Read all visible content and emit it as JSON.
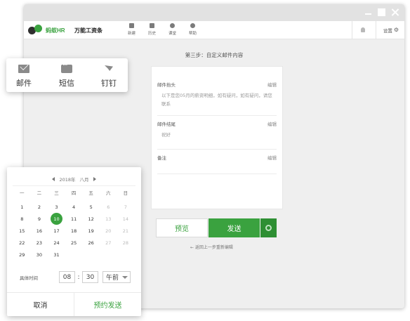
{
  "app": {
    "logo_text": "蚂蚁HR",
    "name": "万能工资条",
    "nav": [
      {
        "label": "新建",
        "icon": "new-doc-icon"
      },
      {
        "label": "历史",
        "icon": "history-icon"
      },
      {
        "label": "课堂",
        "icon": "classroom-icon"
      },
      {
        "label": "帮助",
        "icon": "help-icon"
      }
    ],
    "settings_label": "设置",
    "colors": {
      "accent": "#3aa23f",
      "accent_dark": "#2e8f33"
    }
  },
  "step_title": "第三步：自定义邮件内容",
  "mail": {
    "header": {
      "label": "邮件抬头",
      "edit": "编辑",
      "body": "以下是您05月的薪资明细，如有疑问，如有疑问，请您联系"
    },
    "footer": {
      "label": "邮件结尾",
      "edit": "编辑",
      "body": "祝好"
    },
    "remark": {
      "label": "备注",
      "edit": "编辑"
    }
  },
  "actions": {
    "preview": "预览",
    "send": "发送",
    "back": "← 返回上一步重新编辑"
  },
  "channels": [
    {
      "label": "邮件",
      "icon": "mail-icon"
    },
    {
      "label": "短信",
      "icon": "sms-icon"
    },
    {
      "label": "钉钉",
      "icon": "dingtalk-icon"
    }
  ],
  "calendar": {
    "year": "2018年",
    "month": "八月",
    "weekdays": [
      "一",
      "二",
      "三",
      "四",
      "五",
      "六",
      "日"
    ],
    "days": [
      [
        "1",
        false
      ],
      [
        "2",
        false
      ],
      [
        "3",
        false
      ],
      [
        "4",
        false
      ],
      [
        "5",
        false
      ],
      [
        "6",
        true
      ],
      [
        "7",
        true
      ],
      [
        "8",
        false
      ],
      [
        "9",
        false
      ],
      [
        "10",
        false
      ],
      [
        "11",
        false
      ],
      [
        "12",
        false
      ],
      [
        "13",
        true
      ],
      [
        "14",
        true
      ],
      [
        "15",
        false
      ],
      [
        "16",
        false
      ],
      [
        "17",
        false
      ],
      [
        "18",
        false
      ],
      [
        "19",
        false
      ],
      [
        "20",
        true
      ],
      [
        "21",
        true
      ],
      [
        "22",
        false
      ],
      [
        "23",
        false
      ],
      [
        "24",
        false
      ],
      [
        "25",
        false
      ],
      [
        "26",
        false
      ],
      [
        "27",
        true
      ],
      [
        "28",
        true
      ],
      [
        "29",
        false
      ],
      [
        "30",
        false
      ],
      [
        "31",
        false
      ]
    ],
    "selected_day": "10",
    "time_label": "具体时间",
    "hour": "08",
    "minute": "30",
    "ampm": "午前",
    "cancel": "取消",
    "schedule": "预约发送"
  }
}
